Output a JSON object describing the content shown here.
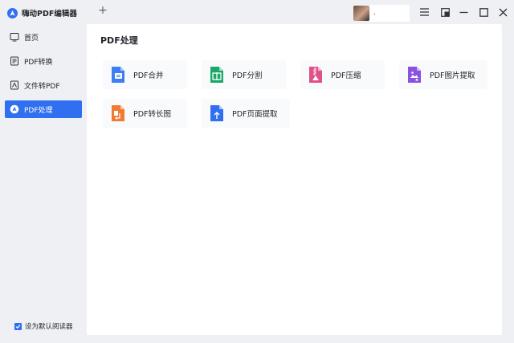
{
  "app": {
    "title": "嗨动PDF编辑器"
  },
  "sidebar": {
    "items": [
      {
        "label": "首页",
        "icon": "home-icon"
      },
      {
        "label": "PDF转换",
        "icon": "convert-icon"
      },
      {
        "label": "文件转PDF",
        "icon": "file-to-pdf-icon"
      },
      {
        "label": "PDF处理",
        "icon": "pdf-process-icon",
        "active": true
      }
    ],
    "default_reader": {
      "label": "设为默认阅读器",
      "checked": true
    }
  },
  "titlebar": {
    "add_tab": "+",
    "user_name": "."
  },
  "main": {
    "section_title": "PDF处理",
    "tools": [
      {
        "label": "PDF合并",
        "icon": "merge-icon",
        "color": "#3d7ef0"
      },
      {
        "label": "PDF分割",
        "icon": "split-icon",
        "color": "#1aa869"
      },
      {
        "label": "PDF压缩",
        "icon": "compress-icon",
        "color": "#e0508a"
      },
      {
        "label": "PDF图片提取",
        "icon": "image-extract-icon",
        "color": "#8a52e0"
      },
      {
        "label": "PDF转长图",
        "icon": "long-image-icon",
        "color": "#f07a2e"
      },
      {
        "label": "PDF页面提取",
        "icon": "page-extract-icon",
        "color": "#2f6ff0"
      }
    ]
  },
  "colors": {
    "accent": "#2f6ff0",
    "background": "#eef0f4",
    "panel": "#ffffff"
  }
}
